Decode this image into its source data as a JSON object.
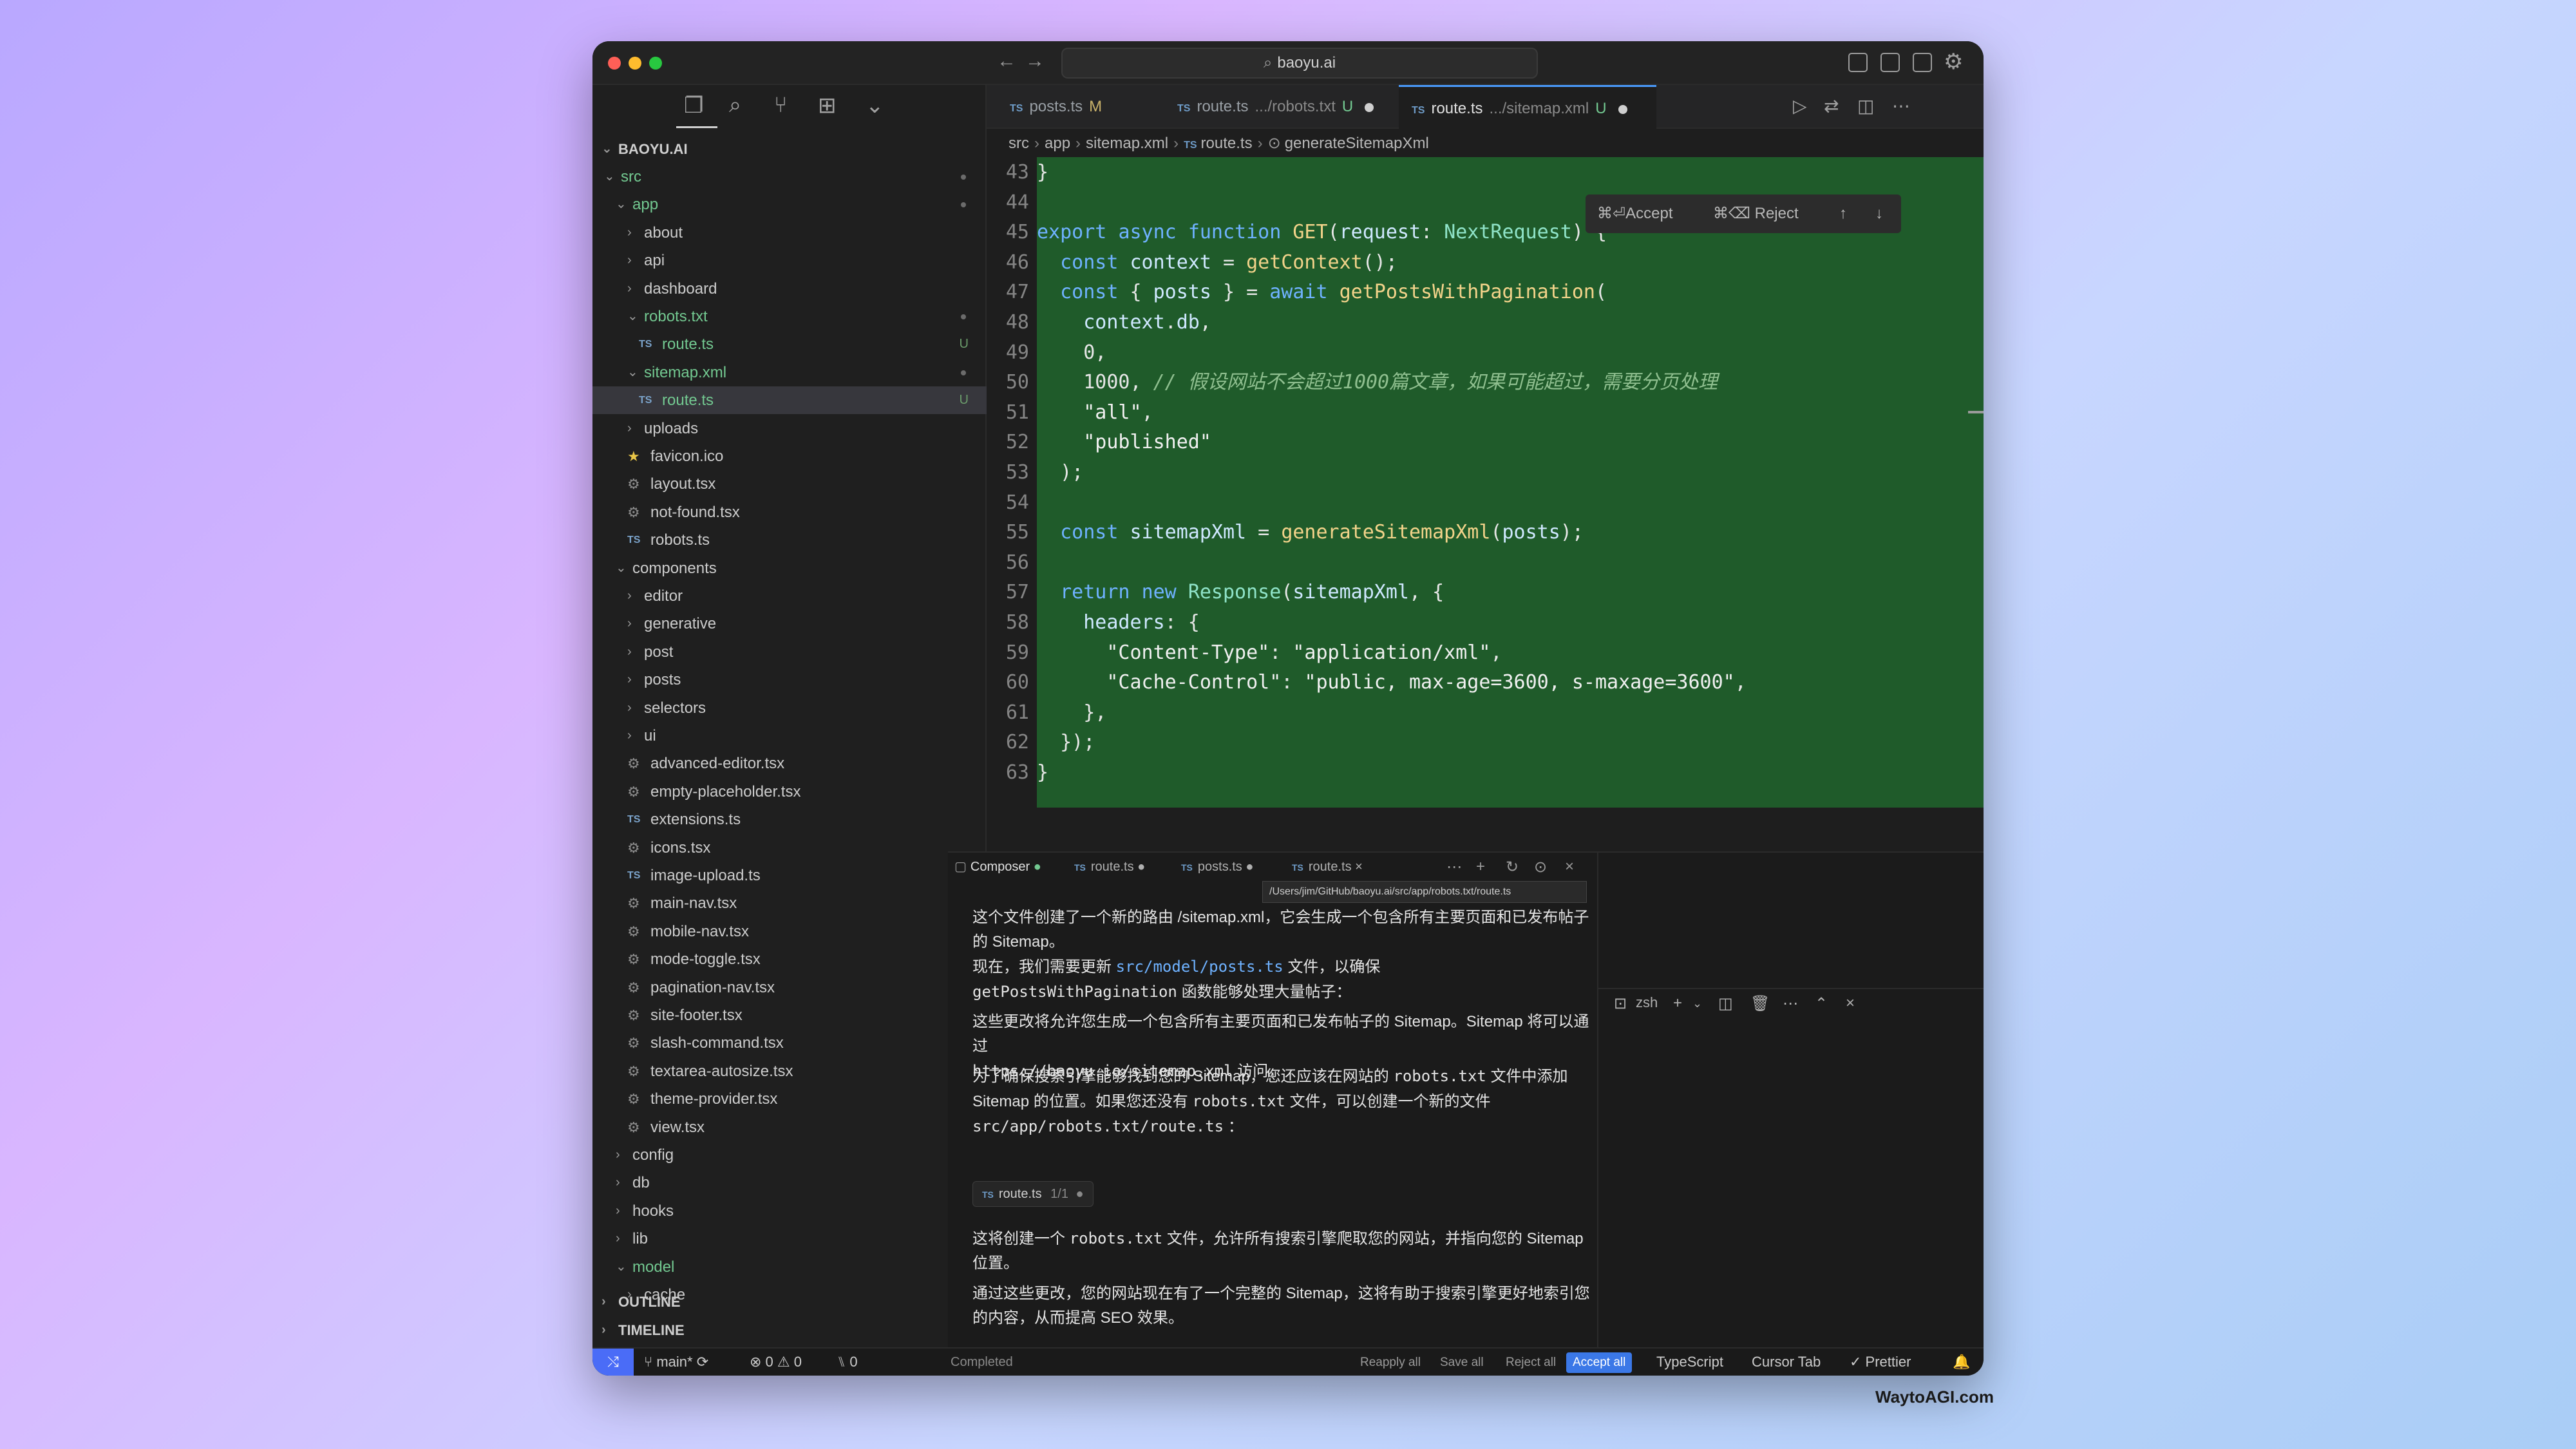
{
  "window": {
    "title": "baoyu.ai"
  },
  "sidebar": {
    "root": "BAOYU.AI",
    "tree": [
      {
        "label": "src",
        "kind": "folder-open",
        "depth": 0,
        "status": "dot",
        "green": true
      },
      {
        "label": "app",
        "kind": "folder-open",
        "depth": 1,
        "status": "dot",
        "green": true
      },
      {
        "label": "about",
        "kind": "folder",
        "depth": 2
      },
      {
        "label": "api",
        "kind": "folder",
        "depth": 2
      },
      {
        "label": "dashboard",
        "kind": "folder",
        "depth": 2
      },
      {
        "label": "robots.txt",
        "kind": "folder-open",
        "depth": 2,
        "status": "dot",
        "green": true
      },
      {
        "label": "route.ts",
        "kind": "ts",
        "depth": 3,
        "status": "U",
        "green": true
      },
      {
        "label": "sitemap.xml",
        "kind": "folder-open",
        "depth": 2,
        "status": "dot",
        "green": true
      },
      {
        "label": "route.ts",
        "kind": "ts",
        "depth": 3,
        "status": "U",
        "green": true,
        "selected": true
      },
      {
        "label": "uploads",
        "kind": "folder",
        "depth": 2
      },
      {
        "label": "favicon.ico",
        "kind": "star",
        "depth": 2
      },
      {
        "label": "layout.tsx",
        "kind": "gear",
        "depth": 2
      },
      {
        "label": "not-found.tsx",
        "kind": "gear",
        "depth": 2
      },
      {
        "label": "robots.ts",
        "kind": "ts",
        "depth": 2
      },
      {
        "label": "components",
        "kind": "folder-open",
        "depth": 1
      },
      {
        "label": "editor",
        "kind": "folder",
        "depth": 2
      },
      {
        "label": "generative",
        "kind": "folder",
        "depth": 2
      },
      {
        "label": "post",
        "kind": "folder",
        "depth": 2
      },
      {
        "label": "posts",
        "kind": "folder",
        "depth": 2
      },
      {
        "label": "selectors",
        "kind": "folder",
        "depth": 2
      },
      {
        "label": "ui",
        "kind": "folder",
        "depth": 2
      },
      {
        "label": "advanced-editor.tsx",
        "kind": "gear",
        "depth": 2
      },
      {
        "label": "empty-placeholder.tsx",
        "kind": "gear",
        "depth": 2
      },
      {
        "label": "extensions.ts",
        "kind": "ts",
        "depth": 2
      },
      {
        "label": "icons.tsx",
        "kind": "gear",
        "depth": 2
      },
      {
        "label": "image-upload.ts",
        "kind": "ts",
        "depth": 2
      },
      {
        "label": "main-nav.tsx",
        "kind": "gear",
        "depth": 2
      },
      {
        "label": "mobile-nav.tsx",
        "kind": "gear",
        "depth": 2
      },
      {
        "label": "mode-toggle.tsx",
        "kind": "gear",
        "depth": 2
      },
      {
        "label": "pagination-nav.tsx",
        "kind": "gear",
        "depth": 2
      },
      {
        "label": "site-footer.tsx",
        "kind": "gear",
        "depth": 2
      },
      {
        "label": "slash-command.tsx",
        "kind": "gear",
        "depth": 2
      },
      {
        "label": "textarea-autosize.tsx",
        "kind": "gear",
        "depth": 2
      },
      {
        "label": "theme-provider.tsx",
        "kind": "gear",
        "depth": 2
      },
      {
        "label": "view.tsx",
        "kind": "gear",
        "depth": 2
      },
      {
        "label": "config",
        "kind": "folder",
        "depth": 1
      },
      {
        "label": "db",
        "kind": "folder",
        "depth": 1
      },
      {
        "label": "hooks",
        "kind": "folder",
        "depth": 1
      },
      {
        "label": "lib",
        "kind": "folder",
        "depth": 1
      },
      {
        "label": "model",
        "kind": "folder-open",
        "depth": 1,
        "green": true
      },
      {
        "label": "cache",
        "kind": "folder",
        "depth": 2
      }
    ],
    "outline": "OUTLINE",
    "timeline": "TIMELINE"
  },
  "editor": {
    "tabs": [
      {
        "label": "posts.ts",
        "badge": "M",
        "path": ""
      },
      {
        "label": "route.ts",
        "badge": "U",
        "path": ".../robots.txt"
      },
      {
        "label": "route.ts",
        "badge": "U",
        "path": ".../sitemap.xml",
        "active": true
      }
    ],
    "breadcrumb": [
      "src",
      "app",
      "sitemap.xml",
      "route.ts",
      "generateSitemapXml"
    ],
    "accept_label": "⌘⏎Accept",
    "reject_label": "⌘⌫ Reject",
    "lines": [
      {
        "n": "43",
        "code": "}"
      },
      {
        "n": "44",
        "code": ""
      },
      {
        "n": "45",
        "code": "export async function GET(request: NextRequest) {"
      },
      {
        "n": "46",
        "code": "  const context = getContext();"
      },
      {
        "n": "47",
        "code": "  const { posts } = await getPostsWithPagination("
      },
      {
        "n": "48",
        "code": "    context.db,"
      },
      {
        "n": "49",
        "code": "    0,"
      },
      {
        "n": "50",
        "code": "    1000, // 假设网站不会超过1000篇文章，如果可能超过，需要分页处理"
      },
      {
        "n": "51",
        "code": "    \"all\","
      },
      {
        "n": "52",
        "code": "    \"published\""
      },
      {
        "n": "53",
        "code": "  );"
      },
      {
        "n": "54",
        "code": ""
      },
      {
        "n": "55",
        "code": "  const sitemapXml = generateSitemapXml(posts);"
      },
      {
        "n": "56",
        "code": ""
      },
      {
        "n": "57",
        "code": "  return new Response(sitemapXml, {"
      },
      {
        "n": "58",
        "code": "    headers: {"
      },
      {
        "n": "59",
        "code": "      \"Content-Type\": \"application/xml\","
      },
      {
        "n": "60",
        "code": "      \"Cache-Control\": \"public, max-age=3600, s-maxage=3600\","
      },
      {
        "n": "61",
        "code": "    },"
      },
      {
        "n": "62",
        "code": "  });"
      },
      {
        "n": "63",
        "code": "}"
      }
    ]
  },
  "composer": {
    "tabs": [
      {
        "label": "Composer",
        "marker": "●"
      },
      {
        "label": "route.ts",
        "marker": "●"
      },
      {
        "label": "posts.ts",
        "marker": "●"
      },
      {
        "label": "route.ts",
        "marker": "×"
      }
    ],
    "path_tooltip": "/Users/jim/GitHub/baoyu.ai/src/app/robots.txt/route.ts",
    "p1": "这个文件创建了一个新的路由 /sitemap.xml，它会生成一个包含所有主要页面和已发布帖子的 Sitemap。",
    "p2a": "现在，我们需要更新",
    "p2_link": "src/model/posts.ts",
    "p2b": "文件，以确保",
    "p2_code": "getPostsWithPagination",
    "p2c": "函数能够处理大量帖子：",
    "p3a": "这些更改将允许您生成一个包含所有主要页面和已发布帖子的 Sitemap。Sitemap 将可以通过",
    "p3_code": "https://baoyu.io/sitemap.xml",
    "p3b": "访问。",
    "p4a": "为了确保搜索引擎能够找到您的 Sitemap，您还应该在网站的",
    "p4_code1": "robots.txt",
    "p4b": "文件中添加 Sitemap 的位置。如果您还没有",
    "p4_code2": "robots.txt",
    "p4c": "文件，可以创建一个新的文件",
    "p4_code3": "src/app/robots.txt/route.ts",
    "p4d": "：",
    "chip_label": "route.ts",
    "chip_count": "1/1",
    "p5a": "这将创建一个",
    "p5_code": "robots.txt",
    "p5b": "文件，允许所有搜索引擎爬取您的网站，并指向您的 Sitemap 位置。",
    "p6": "通过这些更改，您的网站现在有了一个完整的 Sitemap，这将有助于搜索引擎更好地索引您的内容，从而提高 SEO 效果。"
  },
  "terminal": {
    "shell": "zsh"
  },
  "statusbar": {
    "branch": "main*",
    "errors": "0",
    "warnings": "0",
    "ports": "0",
    "completed": "Completed",
    "reapply_all": "Reapply all",
    "save_all": "Save all",
    "reject_all": "Reject all",
    "accept_all": "Accept all",
    "language": "TypeScript",
    "cursor_tab": "Cursor Tab",
    "prettier": "Prettier"
  },
  "watermark": "WaytoAGI.com"
}
